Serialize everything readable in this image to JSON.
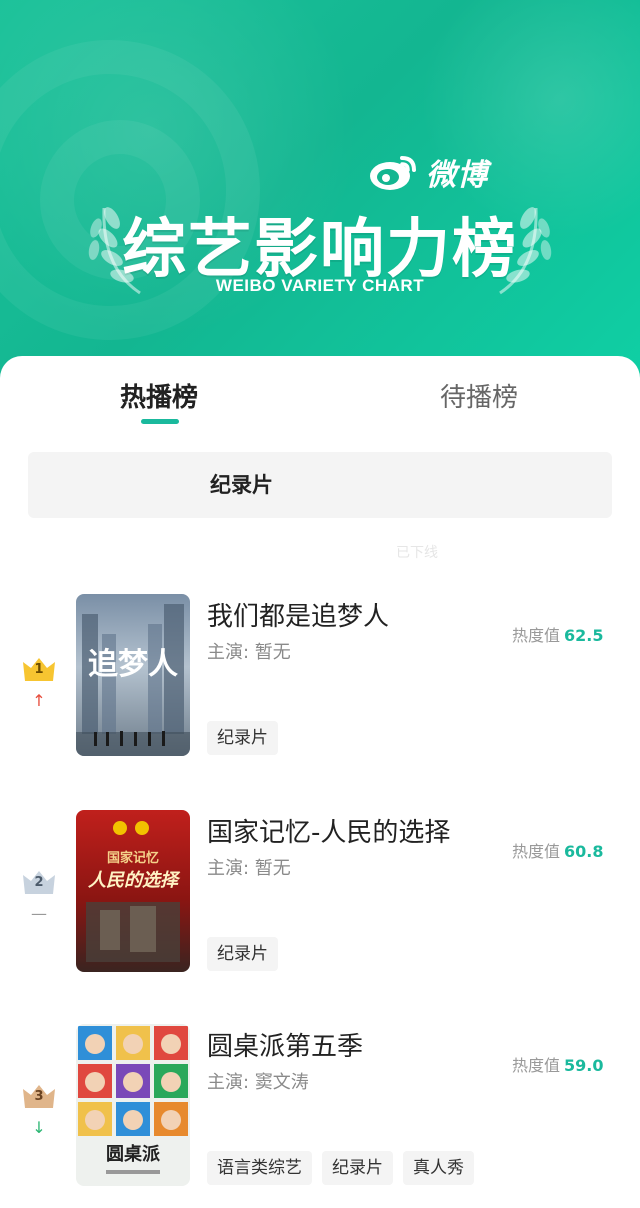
{
  "header": {
    "brand": "微博",
    "title": "综艺影响力榜",
    "subtitle": "WEIBO VARIETY CHART"
  },
  "tabs": [
    {
      "label": "热播榜",
      "active": true
    },
    {
      "label": "待播榜",
      "active": false
    }
  ],
  "category": {
    "label": "纪录片"
  },
  "faint_text": "已下线",
  "colors": {
    "accent": "#1ab99d",
    "header_bg": "#13b691",
    "trend_up": "#e74c3c",
    "trend_down": "#2bb673"
  },
  "items": [
    {
      "rank": "1",
      "trend": "up",
      "trend_icon": "arrow-up-icon",
      "name": "我们都是追梦人",
      "cast": "主演: 暂无",
      "heat_label": "热度值",
      "heat_value": "62.5",
      "tags": [
        "纪录片"
      ],
      "poster_text": "追梦人"
    },
    {
      "rank": "2",
      "trend": "same",
      "trend_icon": "dash-icon",
      "name": "国家记忆-人民的选择",
      "cast": "主演: 暂无",
      "heat_label": "热度值",
      "heat_value": "60.8",
      "tags": [
        "纪录片"
      ],
      "poster_text": "人民的选择"
    },
    {
      "rank": "3",
      "trend": "down",
      "trend_icon": "arrow-down-icon",
      "name": "圆桌派第五季",
      "cast": "主演: 窦文涛",
      "heat_label": "热度值",
      "heat_value": "59.0",
      "tags": [
        "语言类综艺",
        "纪录片",
        "真人秀"
      ],
      "poster_text": "圆桌派"
    }
  ]
}
